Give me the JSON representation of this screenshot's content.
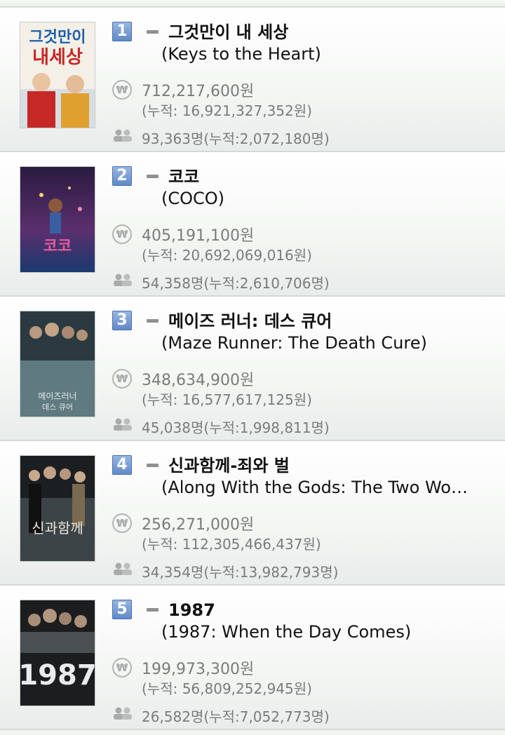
{
  "movies": [
    {
      "rank": "1",
      "change_icon": "dash-icon",
      "title_ko": "그것만이 내 세상",
      "title_en": "(Keys to the Heart)",
      "sales": "712,217,600원",
      "sales_total": "(누적: 16,921,327,352원)",
      "audience": "93,363명(누적:2,072,180명)",
      "poster_title": "그것만이 내세상",
      "poster_colors": [
        "#f4f0e8",
        "#d8dde2",
        "#c62828"
      ]
    },
    {
      "rank": "2",
      "change_icon": "dash-icon",
      "title_ko": "코코",
      "title_en": "(COCO)",
      "sales": "405,191,100원",
      "sales_total": "(누적: 20,692,069,016원)",
      "audience": "54,358명(누적:2,610,706명)",
      "poster_title": "코코",
      "poster_colors": [
        "#2a1b3f",
        "#5b2f6e",
        "#e85a9c"
      ]
    },
    {
      "rank": "3",
      "change_icon": "dash-icon",
      "title_ko": "메이즈 러너: 데스 큐어",
      "title_en": "(Maze Runner: The Death Cure)",
      "sales": "348,634,900원",
      "sales_total": "(누적: 16,577,617,125원)",
      "audience": "45,038명(누적:1,998,811명)",
      "poster_title": "메이즈러너 데스큐어",
      "poster_colors": [
        "#2b3a40",
        "#5f7a80",
        "#c9d2d0"
      ]
    },
    {
      "rank": "4",
      "change_icon": "dash-icon",
      "title_ko": "신과함께-죄와 벌",
      "title_en": "(Along With the Gods: The Two Wo…",
      "sales": "256,271,000원",
      "sales_total": "(누적: 112,305,466,437원)",
      "audience": "34,354명(누적:13,982,793명)",
      "poster_title": "신과함께",
      "poster_colors": [
        "#1c1f22",
        "#3d4448",
        "#c8c2b4"
      ]
    },
    {
      "rank": "5",
      "change_icon": "dash-icon",
      "title_ko": "1987",
      "title_en": "(1987: When the Day Comes)",
      "sales": "199,973,300원",
      "sales_total": "(누적: 56,809,252,945원)",
      "audience": "26,582명(누적:7,052,773명)",
      "poster_title": "1987",
      "poster_colors": [
        "#1b1d1f",
        "#4a4f52",
        "#e9ecec"
      ]
    }
  ],
  "icons": {
    "sales_icon": "won-coin-icon",
    "audience_icon": "people-icon",
    "won_glyph": "₩"
  },
  "colors": {
    "rank_badge": "#6f93cf",
    "muted_text": "#7a7c7b",
    "title_text": "#111111"
  }
}
